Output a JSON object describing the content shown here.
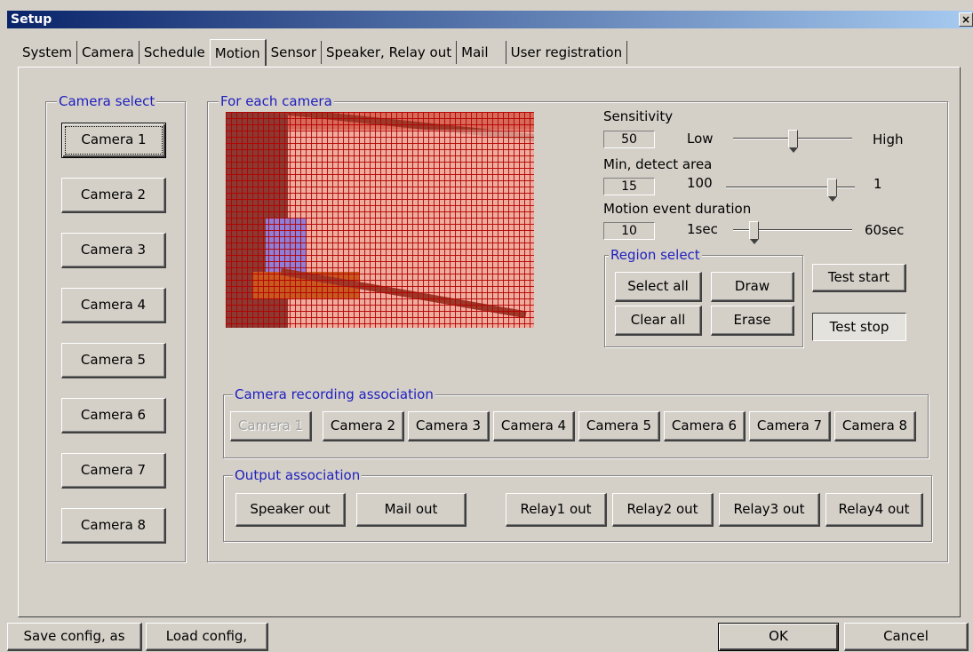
{
  "window": {
    "title": "Setup",
    "close_glyph": "×"
  },
  "tabs": [
    {
      "label": "System"
    },
    {
      "label": "Camera"
    },
    {
      "label": "Schedule"
    },
    {
      "label": "Motion"
    },
    {
      "label": "Sensor"
    },
    {
      "label": "Speaker, Relay out"
    },
    {
      "label": "Mail"
    },
    {
      "label": "User registration"
    }
  ],
  "active_tab": "Motion",
  "camera_select": {
    "title": "Camera select",
    "buttons": [
      "Camera 1",
      "Camera 2",
      "Camera 3",
      "Camera 4",
      "Camera 5",
      "Camera 6",
      "Camera 7",
      "Camera 8"
    ],
    "selected": "Camera 1"
  },
  "for_each_camera": {
    "title": "For each camera",
    "sensitivity": {
      "label": "Sensitivity",
      "value": "50",
      "min_label": "Low",
      "max_label": "High",
      "level": 0.5
    },
    "min_detect_area": {
      "label": "Min, detect area",
      "value": "15",
      "min_label": "100",
      "max_label": "1",
      "level": 0.85
    },
    "motion_event_duration": {
      "label": "Motion event duration",
      "value": "10",
      "min_label": "1sec",
      "max_label": "60sec",
      "level": 0.15
    },
    "region_select": {
      "title": "Region select",
      "select_all": "Select all",
      "draw": "Draw",
      "clear_all": "Clear all",
      "erase": "Erase"
    },
    "test_start": "Test start",
    "test_stop": "Test stop"
  },
  "recording_association": {
    "title": "Camera recording association",
    "buttons": [
      "Camera 1",
      "Camera 2",
      "Camera 3",
      "Camera 4",
      "Camera 5",
      "Camera 6",
      "Camera 7",
      "Camera 8"
    ],
    "disabled": "Camera 1"
  },
  "output_association": {
    "title": "Output association",
    "speaker_out": "Speaker out",
    "mail_out": "Mail out",
    "relay1_out": "Relay1 out",
    "relay2_out": "Relay2 out",
    "relay3_out": "Relay3 out",
    "relay4_out": "Relay4 out"
  },
  "footer": {
    "save_config": "Save config, as",
    "load_config": "Load config,",
    "ok": "OK",
    "cancel": "Cancel"
  }
}
